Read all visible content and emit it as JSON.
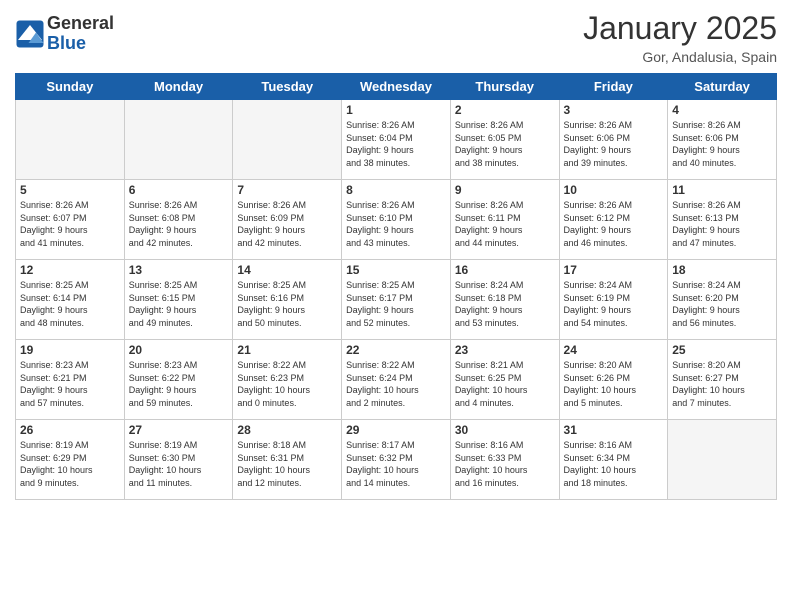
{
  "header": {
    "logo_line1": "General",
    "logo_line2": "Blue",
    "title": "January 2025",
    "subtitle": "Gor, Andalusia, Spain"
  },
  "days_of_week": [
    "Sunday",
    "Monday",
    "Tuesday",
    "Wednesday",
    "Thursday",
    "Friday",
    "Saturday"
  ],
  "weeks": [
    [
      {
        "day": "",
        "info": ""
      },
      {
        "day": "",
        "info": ""
      },
      {
        "day": "",
        "info": ""
      },
      {
        "day": "1",
        "info": "Sunrise: 8:26 AM\nSunset: 6:04 PM\nDaylight: 9 hours\nand 38 minutes."
      },
      {
        "day": "2",
        "info": "Sunrise: 8:26 AM\nSunset: 6:05 PM\nDaylight: 9 hours\nand 38 minutes."
      },
      {
        "day": "3",
        "info": "Sunrise: 8:26 AM\nSunset: 6:06 PM\nDaylight: 9 hours\nand 39 minutes."
      },
      {
        "day": "4",
        "info": "Sunrise: 8:26 AM\nSunset: 6:06 PM\nDaylight: 9 hours\nand 40 minutes."
      }
    ],
    [
      {
        "day": "5",
        "info": "Sunrise: 8:26 AM\nSunset: 6:07 PM\nDaylight: 9 hours\nand 41 minutes."
      },
      {
        "day": "6",
        "info": "Sunrise: 8:26 AM\nSunset: 6:08 PM\nDaylight: 9 hours\nand 42 minutes."
      },
      {
        "day": "7",
        "info": "Sunrise: 8:26 AM\nSunset: 6:09 PM\nDaylight: 9 hours\nand 42 minutes."
      },
      {
        "day": "8",
        "info": "Sunrise: 8:26 AM\nSunset: 6:10 PM\nDaylight: 9 hours\nand 43 minutes."
      },
      {
        "day": "9",
        "info": "Sunrise: 8:26 AM\nSunset: 6:11 PM\nDaylight: 9 hours\nand 44 minutes."
      },
      {
        "day": "10",
        "info": "Sunrise: 8:26 AM\nSunset: 6:12 PM\nDaylight: 9 hours\nand 46 minutes."
      },
      {
        "day": "11",
        "info": "Sunrise: 8:26 AM\nSunset: 6:13 PM\nDaylight: 9 hours\nand 47 minutes."
      }
    ],
    [
      {
        "day": "12",
        "info": "Sunrise: 8:25 AM\nSunset: 6:14 PM\nDaylight: 9 hours\nand 48 minutes."
      },
      {
        "day": "13",
        "info": "Sunrise: 8:25 AM\nSunset: 6:15 PM\nDaylight: 9 hours\nand 49 minutes."
      },
      {
        "day": "14",
        "info": "Sunrise: 8:25 AM\nSunset: 6:16 PM\nDaylight: 9 hours\nand 50 minutes."
      },
      {
        "day": "15",
        "info": "Sunrise: 8:25 AM\nSunset: 6:17 PM\nDaylight: 9 hours\nand 52 minutes."
      },
      {
        "day": "16",
        "info": "Sunrise: 8:24 AM\nSunset: 6:18 PM\nDaylight: 9 hours\nand 53 minutes."
      },
      {
        "day": "17",
        "info": "Sunrise: 8:24 AM\nSunset: 6:19 PM\nDaylight: 9 hours\nand 54 minutes."
      },
      {
        "day": "18",
        "info": "Sunrise: 8:24 AM\nSunset: 6:20 PM\nDaylight: 9 hours\nand 56 minutes."
      }
    ],
    [
      {
        "day": "19",
        "info": "Sunrise: 8:23 AM\nSunset: 6:21 PM\nDaylight: 9 hours\nand 57 minutes."
      },
      {
        "day": "20",
        "info": "Sunrise: 8:23 AM\nSunset: 6:22 PM\nDaylight: 9 hours\nand 59 minutes."
      },
      {
        "day": "21",
        "info": "Sunrise: 8:22 AM\nSunset: 6:23 PM\nDaylight: 10 hours\nand 0 minutes."
      },
      {
        "day": "22",
        "info": "Sunrise: 8:22 AM\nSunset: 6:24 PM\nDaylight: 10 hours\nand 2 minutes."
      },
      {
        "day": "23",
        "info": "Sunrise: 8:21 AM\nSunset: 6:25 PM\nDaylight: 10 hours\nand 4 minutes."
      },
      {
        "day": "24",
        "info": "Sunrise: 8:20 AM\nSunset: 6:26 PM\nDaylight: 10 hours\nand 5 minutes."
      },
      {
        "day": "25",
        "info": "Sunrise: 8:20 AM\nSunset: 6:27 PM\nDaylight: 10 hours\nand 7 minutes."
      }
    ],
    [
      {
        "day": "26",
        "info": "Sunrise: 8:19 AM\nSunset: 6:29 PM\nDaylight: 10 hours\nand 9 minutes."
      },
      {
        "day": "27",
        "info": "Sunrise: 8:19 AM\nSunset: 6:30 PM\nDaylight: 10 hours\nand 11 minutes."
      },
      {
        "day": "28",
        "info": "Sunrise: 8:18 AM\nSunset: 6:31 PM\nDaylight: 10 hours\nand 12 minutes."
      },
      {
        "day": "29",
        "info": "Sunrise: 8:17 AM\nSunset: 6:32 PM\nDaylight: 10 hours\nand 14 minutes."
      },
      {
        "day": "30",
        "info": "Sunrise: 8:16 AM\nSunset: 6:33 PM\nDaylight: 10 hours\nand 16 minutes."
      },
      {
        "day": "31",
        "info": "Sunrise: 8:16 AM\nSunset: 6:34 PM\nDaylight: 10 hours\nand 18 minutes."
      },
      {
        "day": "",
        "info": ""
      }
    ]
  ]
}
